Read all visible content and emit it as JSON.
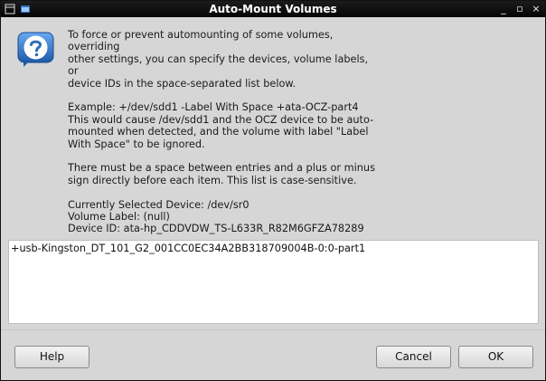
{
  "window": {
    "title": "Auto-Mount Volumes"
  },
  "icons": {
    "app": "pane-icon",
    "menu": "window-menu-icon",
    "dialog": "question-icon",
    "close": "close-icon"
  },
  "message": {
    "intro": "To force or prevent automounting of some volumes, overriding\nother settings, you can specify the devices, volume labels, or\ndevice IDs in the space-separated list below.",
    "example": "Example:  +/dev/sdd1 -Label With Space +ata-OCZ-part4\nThis would cause /dev/sdd1 and the OCZ device to be auto-\nmounted when detected, and the volume with label \"Label\nWith Space\" to be ignored.",
    "rules": "There must be a space between entries and a plus or minus\nsign directly before each item.  This list is case-sensitive.",
    "current_device": "Currently Selected Device: /dev/sr0",
    "volume_label": "Volume Label: (null)",
    "device_id": "Device ID: ata-hp_CDDVDW_TS-L633R_R82M6GFZA78289"
  },
  "list": {
    "value": "+usb-Kingston_DT_101_G2_001CC0EC34A2BB318709004B-0:0-part1"
  },
  "buttons": {
    "help": "Help",
    "cancel": "Cancel",
    "ok": "OK"
  },
  "titlebar_buttons": {
    "minimize": "_",
    "maximize": "▫",
    "close": "×"
  },
  "colors": {
    "dialog_bg": "#d6d6d6",
    "titlebar_bg": "#0a0a0a",
    "icon_blue": "#2f6fb8"
  }
}
